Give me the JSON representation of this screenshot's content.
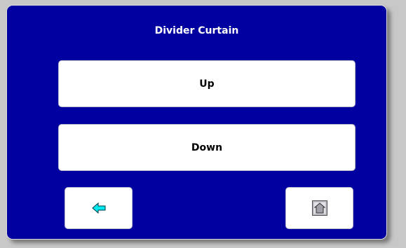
{
  "panel": {
    "title": "Divider Curtain"
  },
  "buttons": {
    "up_label": "Up",
    "down_label": "Down"
  },
  "nav": {
    "back_icon": "left-arrow-icon",
    "home_icon": "home-icon"
  },
  "colors": {
    "panel_background": "#0000a0",
    "button_background": "#ffffff",
    "arrow_fill": "#00e8f0",
    "home_icon_fill": "#a0a0a8"
  }
}
